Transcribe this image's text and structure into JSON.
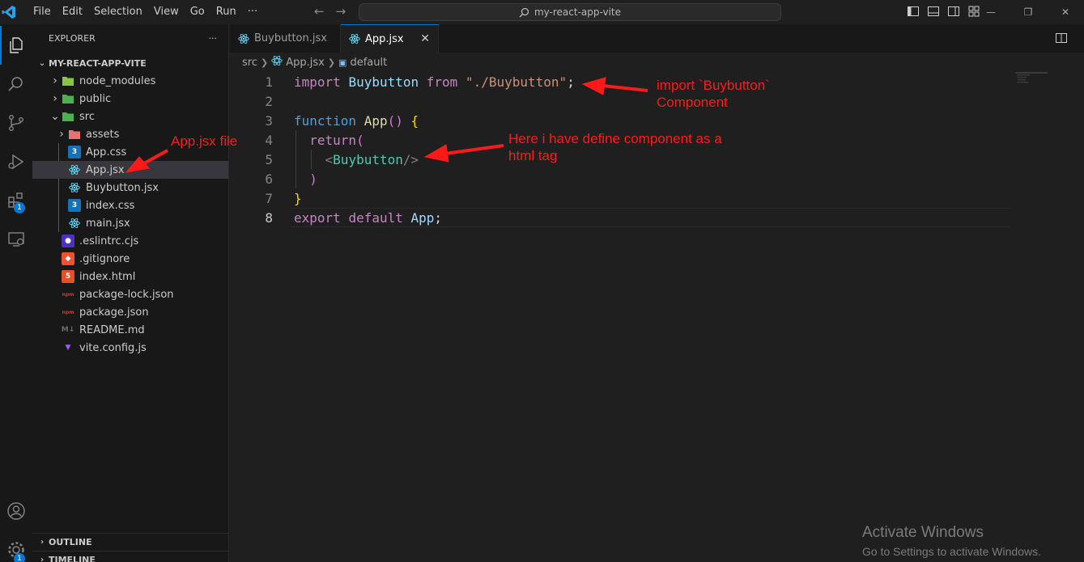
{
  "titlebar": {
    "menu": [
      "File",
      "Edit",
      "Selection",
      "View",
      "Go",
      "Run",
      "···"
    ],
    "search_text": "my-react-app-vite"
  },
  "activity": {
    "extensions_badge": "1",
    "settings_badge": "1"
  },
  "sidebar": {
    "header": "EXPLORER",
    "more": "···",
    "root": "MY-REACT-APP-VITE",
    "tree": [
      {
        "label": "node_modules",
        "type": "folder",
        "depth": 0,
        "collapsed": true
      },
      {
        "label": "public",
        "type": "folder",
        "depth": 0,
        "collapsed": true
      },
      {
        "label": "src",
        "type": "folder",
        "depth": 0,
        "collapsed": false
      },
      {
        "label": "assets",
        "type": "folder",
        "depth": 1,
        "collapsed": true
      },
      {
        "label": "App.css",
        "type": "css",
        "depth": 1
      },
      {
        "label": "App.jsx",
        "type": "react",
        "depth": 1,
        "selected": true
      },
      {
        "label": "Buybutton.jsx",
        "type": "react",
        "depth": 1
      },
      {
        "label": "index.css",
        "type": "css",
        "depth": 1
      },
      {
        "label": "main.jsx",
        "type": "react",
        "depth": 1
      },
      {
        "label": ".eslintrc.cjs",
        "type": "eslint",
        "depth": 0
      },
      {
        "label": ".gitignore",
        "type": "git",
        "depth": 0
      },
      {
        "label": "index.html",
        "type": "html",
        "depth": 0
      },
      {
        "label": "package-lock.json",
        "type": "json",
        "depth": 0
      },
      {
        "label": "package.json",
        "type": "json",
        "depth": 0
      },
      {
        "label": "README.md",
        "type": "md",
        "depth": 0
      },
      {
        "label": "vite.config.js",
        "type": "vite",
        "depth": 0
      }
    ],
    "outline": "OUTLINE",
    "timeline": "TIMELINE"
  },
  "tabs": [
    {
      "label": "Buybutton.jsx",
      "active": false
    },
    {
      "label": "App.jsx",
      "active": true,
      "close": "✕"
    }
  ],
  "breadcrumb": [
    "src",
    "App.jsx",
    "default"
  ],
  "editor": {
    "line_numbers": [
      "1",
      "2",
      "3",
      "4",
      "5",
      "6",
      "7",
      "8"
    ],
    "active_line": "8",
    "lines": {
      "l1": {
        "kw": "import",
        "id": "Buybutton",
        "from": "from",
        "str": "\"./Buybutton\"",
        "semi": ";"
      },
      "l3": {
        "kw": "function",
        "fn": "App",
        "parens": "()",
        "brace": "{"
      },
      "l4": {
        "kw": "return",
        "paren": "("
      },
      "l5": {
        "open": "<",
        "comp": "Buybutton",
        "close": "/>"
      },
      "l6": {
        "paren": ")"
      },
      "l7": {
        "brace": "}"
      },
      "l8": {
        "kw": "export",
        "kw2": "default",
        "id": "App",
        "semi": ";"
      }
    }
  },
  "annotations": {
    "app_file": "App.jsx file",
    "import_note": "import `Buybutton`\nComponent",
    "tag_note": "Here i have define component as a\nhtml tag"
  },
  "watermark": {
    "title": "Activate Windows",
    "subtitle": "Go to Settings to activate Windows."
  },
  "colors": {
    "accent": "#0078d4",
    "annotation": "#ff1a1a"
  }
}
